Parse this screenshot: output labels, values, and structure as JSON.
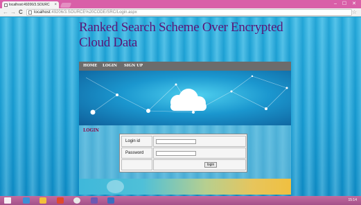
{
  "browser": {
    "tab_title": "localhost:49206/3.SOURC",
    "tab_close": "×",
    "window_controls": "– ☐ ✕",
    "nav": {
      "back": "←",
      "forward": "→",
      "reload": "C"
    },
    "url_host": "localhost",
    "url_rest": ":49206/3.SOURCE%20CODE/SRC/Login.aspx",
    "bookmark_star": "☆"
  },
  "page": {
    "title": "Ranked Search Scheme Over Encrypted Cloud Data",
    "nav": [
      "HOME",
      "LOGIN",
      "SIGN UP"
    ],
    "section_heading": "LOGIN",
    "form": {
      "login_id_label": "Login id",
      "password_label": "Password",
      "login_id_value": "",
      "password_value": "",
      "submit_label": "login"
    }
  },
  "taskbar": {
    "clock": "15:14"
  }
}
